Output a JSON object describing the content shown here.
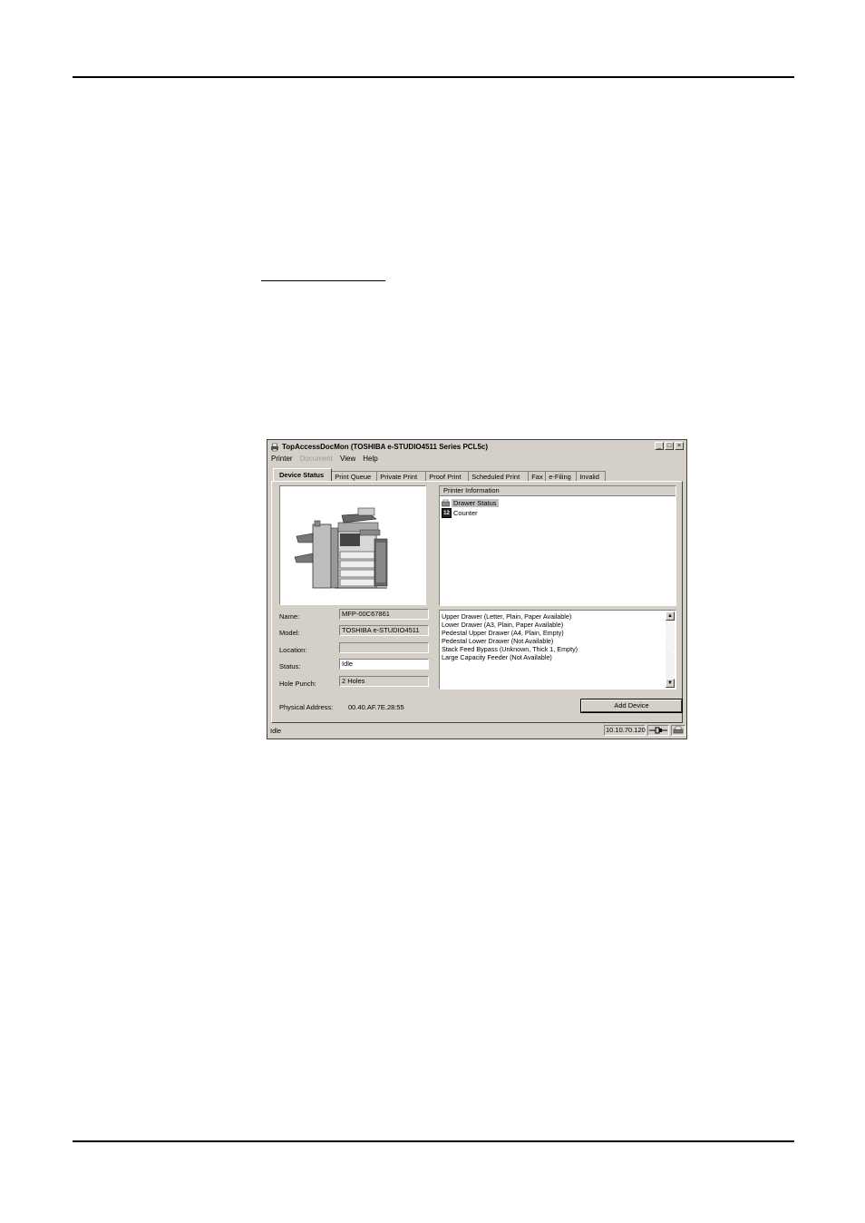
{
  "window": {
    "title": "TopAccessDocMon (TOSHIBA e-STUDIO4511 Series PCL5c)",
    "controls": {
      "minimize": "_",
      "maximize": "□",
      "close": "×"
    }
  },
  "menu": {
    "items": [
      "Printer",
      "Document",
      "View",
      "Help"
    ],
    "disabled": [
      "Document"
    ]
  },
  "tabs": [
    {
      "label": "Device Status",
      "active": true
    },
    {
      "label": "Print Queue"
    },
    {
      "label": "Private Print"
    },
    {
      "label": "Proof Print"
    },
    {
      "label": "Scheduled Print"
    },
    {
      "label": "Fax"
    },
    {
      "label": "e-Filing"
    },
    {
      "label": "Invalid"
    }
  ],
  "printer_info": {
    "header": "Printer Information",
    "items": [
      {
        "label": "Drawer Status",
        "icon": "drawer-icon",
        "selected": true
      },
      {
        "label": "Counter",
        "icon": "counter-icon",
        "icon_text": "12"
      }
    ]
  },
  "fields": {
    "name": {
      "label": "Name:",
      "value": "MFP-00C67861"
    },
    "model": {
      "label": "Model:",
      "value": "TOSHIBA e-STUDIO4511"
    },
    "location": {
      "label": "Location:",
      "value": ""
    },
    "status": {
      "label": "Status:",
      "value": "Idle"
    },
    "hole_punch": {
      "label": "Hole Punch:",
      "value": "2 Holes"
    },
    "physical_address": {
      "label": "Physical Address:",
      "value": "00.40.AF.7E.28:55"
    }
  },
  "drawer_status": [
    "Upper Drawer (Letter, Plain, Paper Available)",
    "Lower Drawer (A3, Plain, Paper Available)",
    "Pedestal Upper Drawer (A4, Plain, Empty)",
    "Pedestal Lower Drawer (Not Available)",
    "Stack Feed Bypass (Unknown, Thick 1, Empty)",
    "Large Capacity Feeder (Not Available)"
  ],
  "buttons": {
    "add_device": "Add Device"
  },
  "statusbar": {
    "text": "Idle",
    "ip": "10.10.70.120"
  }
}
